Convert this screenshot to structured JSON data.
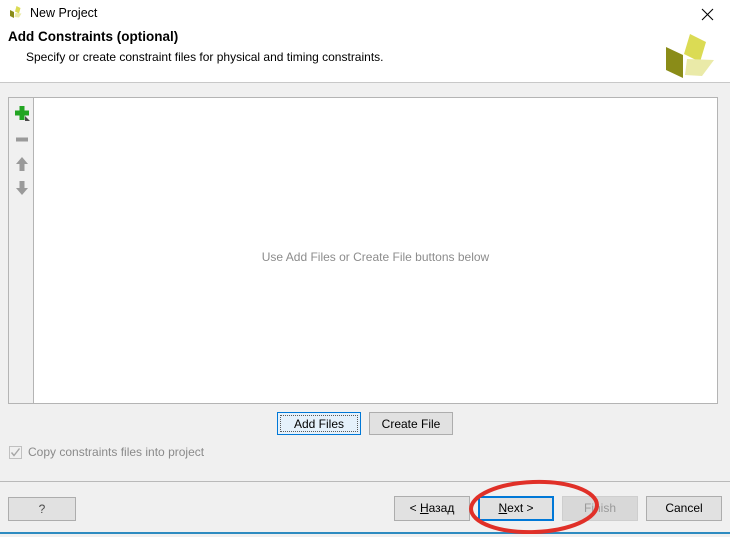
{
  "titlebar": {
    "title": "New Project",
    "app_icon": "xilinx-logo-icon",
    "close_label": "✕"
  },
  "header": {
    "title": "Add Constraints (optional)",
    "subtitle": "Specify or create constraint files for physical and timing constraints.",
    "logo": "xilinx-logo-icon"
  },
  "list_toolbar": {
    "items": [
      {
        "name": "add-icon",
        "glyph": "+"
      },
      {
        "name": "remove-icon",
        "glyph": "−"
      },
      {
        "name": "move-up-icon",
        "glyph": "↑"
      },
      {
        "name": "move-down-icon",
        "glyph": "↓"
      }
    ]
  },
  "list_panel": {
    "placeholder": "Use Add Files or Create File buttons below",
    "rows": []
  },
  "file_buttons": {
    "add_files_label": "Add Files",
    "create_file_label": "Create File"
  },
  "copy_option": {
    "label": "Copy constraints files into project",
    "checked": true,
    "enabled": false,
    "check_glyph": "✓"
  },
  "footer": {
    "help_label": "?",
    "back_label_prefix": "< ",
    "back_label_key": "Н",
    "back_label_suffix": "азад",
    "next_label_key": "N",
    "next_label_suffix": "ext >",
    "finish_label": "Finish",
    "cancel_label": "Cancel"
  },
  "colors": {
    "accent_blue": "#0078d7",
    "bottom_accent": "#2e8bc0",
    "annotation_red": "#e03028",
    "logo_dark": "#8a8c18",
    "logo_mid": "#dbdb54",
    "logo_light": "#eaeaa8",
    "add_icon_green": "#22a522",
    "dialog_bg": "#f0f0f0",
    "panel_bg": "#ffffff",
    "placeholder_text": "#8c8c8c",
    "disabled_text": "#8a8a8a"
  },
  "annotation": {
    "shape": "ellipse",
    "target": "next-button",
    "color": "#e03028"
  }
}
